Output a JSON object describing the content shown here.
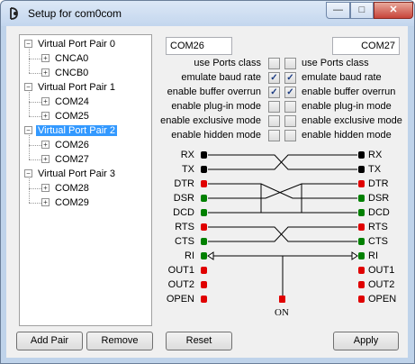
{
  "window": {
    "title": "Setup for com0com"
  },
  "tree": {
    "pairs": [
      {
        "label": "Virtual Port Pair 0",
        "ports": [
          "CNCA0",
          "CNCB0"
        ]
      },
      {
        "label": "Virtual Port Pair 1",
        "ports": [
          "COM24",
          "COM25"
        ]
      },
      {
        "label": "Virtual Port Pair 2",
        "ports": [
          "COM26",
          "COM27"
        ],
        "selected": true
      },
      {
        "label": "Virtual Port Pair 3",
        "ports": [
          "COM28",
          "COM29"
        ]
      }
    ],
    "collapse_glyph": "−",
    "expand_glyph": "+"
  },
  "ports": {
    "left": "COM26",
    "right": "COM27"
  },
  "options": [
    {
      "label": "use Ports class",
      "left": false,
      "right": false
    },
    {
      "label": "emulate baud rate",
      "left": true,
      "right": true
    },
    {
      "label": "enable buffer overrun",
      "left": true,
      "right": true
    },
    {
      "label": "enable plug-in mode",
      "left": false,
      "right": false
    },
    {
      "label": "enable exclusive mode",
      "left": false,
      "right": false
    },
    {
      "label": "enable hidden mode",
      "left": false,
      "right": false
    }
  ],
  "signals": {
    "left": [
      "RX",
      "TX",
      "DTR",
      "DSR",
      "DCD",
      "RTS",
      "CTS",
      "RI",
      "OUT1",
      "OUT2",
      "OPEN"
    ],
    "right": [
      "RX",
      "TX",
      "DTR",
      "DSR",
      "DCD",
      "RTS",
      "CTS",
      "RI",
      "OUT1",
      "OUT2",
      "OPEN"
    ],
    "colors": [
      "#000000",
      "#000000",
      "#e00000",
      "#008000",
      "#008000",
      "#e00000",
      "#008000",
      "#008000",
      "#e00000",
      "#e00000",
      "#e00000"
    ],
    "on_label": "ON"
  },
  "buttons": {
    "add_pair": "Add Pair",
    "remove": "Remove",
    "reset": "Reset",
    "apply": "Apply"
  },
  "titlebar_buttons": {
    "minimize": "—",
    "maximize": "□",
    "close": "✕"
  }
}
